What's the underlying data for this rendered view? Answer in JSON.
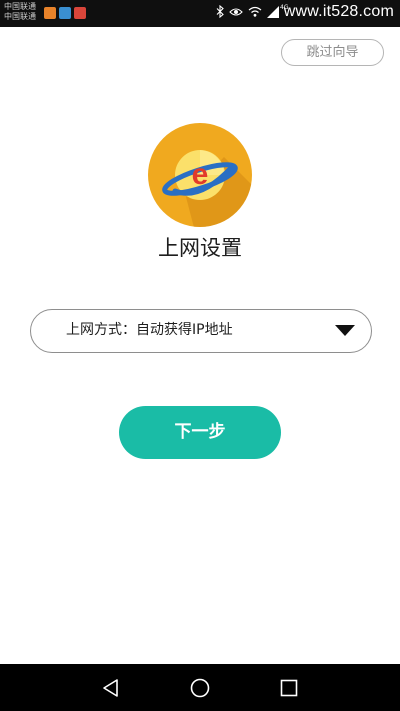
{
  "status_bar": {
    "carrier_1": "中国联通",
    "carrier_2": "中国联通",
    "signal_label": "4G",
    "watermark": "www.it528.com",
    "icons": [
      "weibo-icon",
      "telegram-icon",
      "app-icon",
      "bluetooth-icon",
      "eye-icon",
      "wifi-icon",
      "signal-icon"
    ]
  },
  "skip_label": "跳过向导",
  "page_title": "上网设置",
  "logo": {
    "icon": "browser-planet-icon",
    "accent": "#f0a91f"
  },
  "connection_select": {
    "label": "上网方式：自动获得IP地址"
  },
  "next_label": "下一步",
  "colors": {
    "primary": "#1abca6",
    "text": "#1e1e1e",
    "muted": "#8c8c8c"
  },
  "nav_bar": {
    "back": "back-icon",
    "home": "home-icon",
    "recent": "recent-apps-icon"
  }
}
